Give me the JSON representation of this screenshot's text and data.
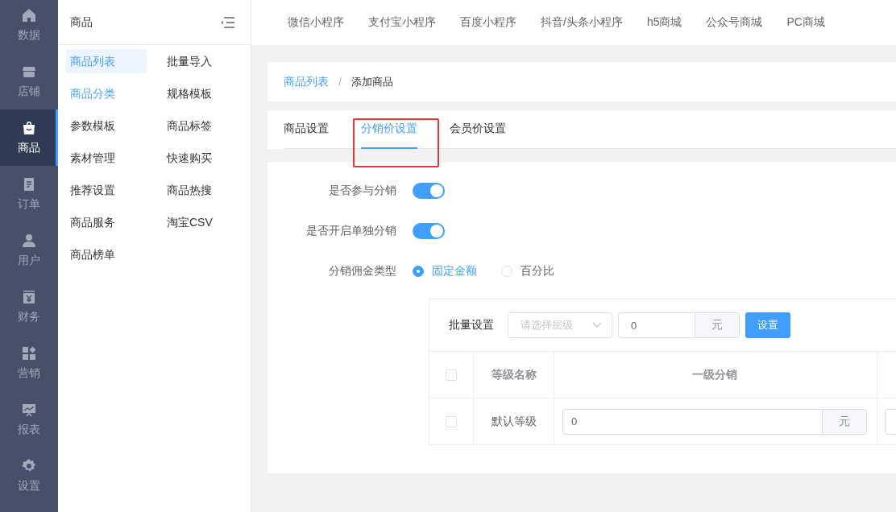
{
  "rail": [
    {
      "label": "数据",
      "selected": false
    },
    {
      "label": "店铺",
      "selected": false
    },
    {
      "label": "商品",
      "selected": true
    },
    {
      "label": "订单",
      "selected": false
    },
    {
      "label": "用户",
      "selected": false
    },
    {
      "label": "财务",
      "selected": false
    },
    {
      "label": "营销",
      "selected": false
    },
    {
      "label": "报表",
      "selected": false
    },
    {
      "label": "设置",
      "selected": false
    }
  ],
  "sidebar": {
    "title": "商品",
    "items": [
      {
        "label": "商品列表",
        "selected": true,
        "hovered": false
      },
      {
        "label": "批量导入",
        "selected": false,
        "hovered": false
      },
      {
        "label": "商品分类",
        "selected": false,
        "hovered": true
      },
      {
        "label": "规格模板",
        "selected": false,
        "hovered": false
      },
      {
        "label": "参数模板",
        "selected": false,
        "hovered": false
      },
      {
        "label": "商品标签",
        "selected": false,
        "hovered": false
      },
      {
        "label": "素材管理",
        "selected": false,
        "hovered": false
      },
      {
        "label": "快速购买",
        "selected": false,
        "hovered": false
      },
      {
        "label": "推荐设置",
        "selected": false,
        "hovered": false
      },
      {
        "label": "商品热搜",
        "selected": false,
        "hovered": false
      },
      {
        "label": "商品服务",
        "selected": false,
        "hovered": false
      },
      {
        "label": "淘宝CSV",
        "selected": false,
        "hovered": false
      },
      {
        "label": "商品榜单",
        "selected": false,
        "hovered": false
      }
    ]
  },
  "top_nav": [
    "微信小程序",
    "支付宝小程序",
    "百度小程序",
    "抖音/头条小程序",
    "h5商城",
    "公众号商城",
    "PC商城"
  ],
  "breadcrumb": {
    "separator": "/",
    "items": [
      {
        "label": "商品列表",
        "kind": "link"
      },
      {
        "label": "添加商品",
        "kind": "current"
      }
    ]
  },
  "tabs": [
    {
      "label": "商品设置",
      "selected": false,
      "highlighted": false
    },
    {
      "label": "分销价设置",
      "selected": true,
      "highlighted": true
    },
    {
      "label": "会员价设置",
      "selected": false,
      "highlighted": false
    }
  ],
  "form": {
    "rows": [
      {
        "kind": "switch",
        "label": "是否参与分销",
        "on": true
      },
      {
        "kind": "switch",
        "label": "是否开启单独分销",
        "on": true
      },
      {
        "kind": "radio",
        "label": "分销佣金类型",
        "options": [
          {
            "label": "固定金额",
            "selected": true
          },
          {
            "label": "百分比",
            "selected": false
          }
        ]
      }
    ]
  },
  "commission_table": {
    "batch": {
      "label": "批量设置",
      "select": {
        "placeholder": "请选择层级"
      },
      "value": "0",
      "unit": "元",
      "button": "设置"
    },
    "header_checked": false,
    "columns": [
      "等级名称",
      "一级分销"
    ],
    "rows": [
      {
        "checked": false,
        "name": "默认等级",
        "value": "0",
        "unit": "元"
      }
    ]
  }
}
